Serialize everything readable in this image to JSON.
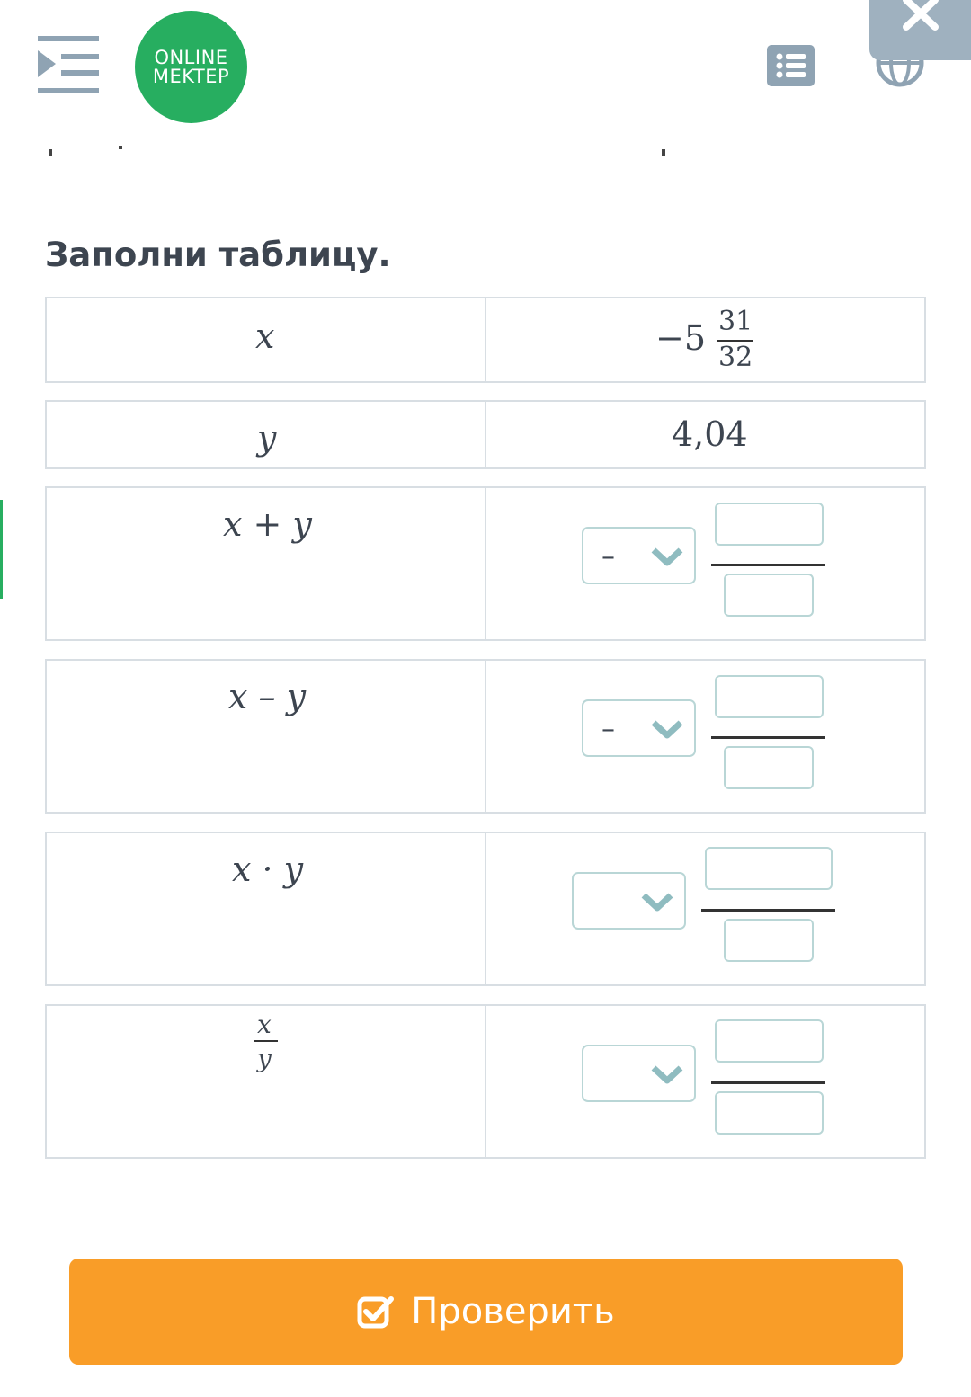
{
  "logo": {
    "line1": "ONLINE",
    "line2": "MEKTEP"
  },
  "task": {
    "title": "Заполни таблицу."
  },
  "table": {
    "rows": [
      {
        "label": "x",
        "value_whole": "−5",
        "value_num": "31",
        "value_den": "32"
      },
      {
        "label": "y",
        "value": "4,04"
      },
      {
        "label": "x + y",
        "sign": "–"
      },
      {
        "label": "x – y",
        "sign": "–"
      },
      {
        "label": "x · y",
        "sign": ""
      },
      {
        "label_num": "x",
        "label_den": "y",
        "sign": ""
      }
    ]
  },
  "button": {
    "check_label": "Проверить"
  },
  "colors": {
    "accent_green": "#27ae60",
    "button_orange": "#f99d28",
    "input_border": "#b9d6d6",
    "chevron": "#8fbcc0"
  }
}
